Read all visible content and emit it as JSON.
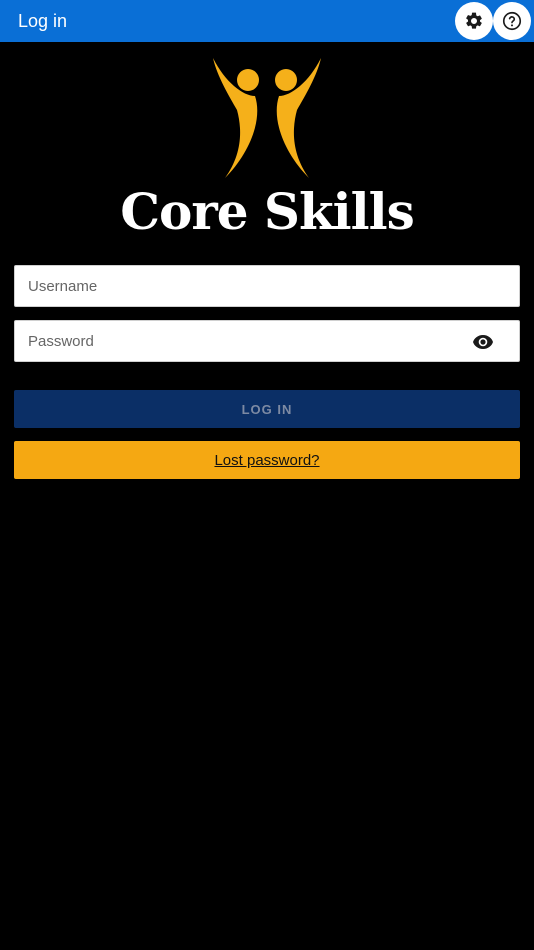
{
  "header": {
    "title": "Log in",
    "settings_icon": "gear-icon",
    "help_icon": "question-circle-icon",
    "background_color": "#0a6fd6"
  },
  "logo": {
    "text": "Core Skills",
    "figure_color": "#f5b01a"
  },
  "form": {
    "username_placeholder": "Username",
    "username_value": "",
    "password_placeholder": "Password",
    "password_value": "",
    "password_toggle_icon": "eye-icon",
    "login_label": "LOG IN",
    "login_color": "#0b2f66",
    "lost_password_label": "Lost password?",
    "lost_password_color": "#f5a812"
  }
}
